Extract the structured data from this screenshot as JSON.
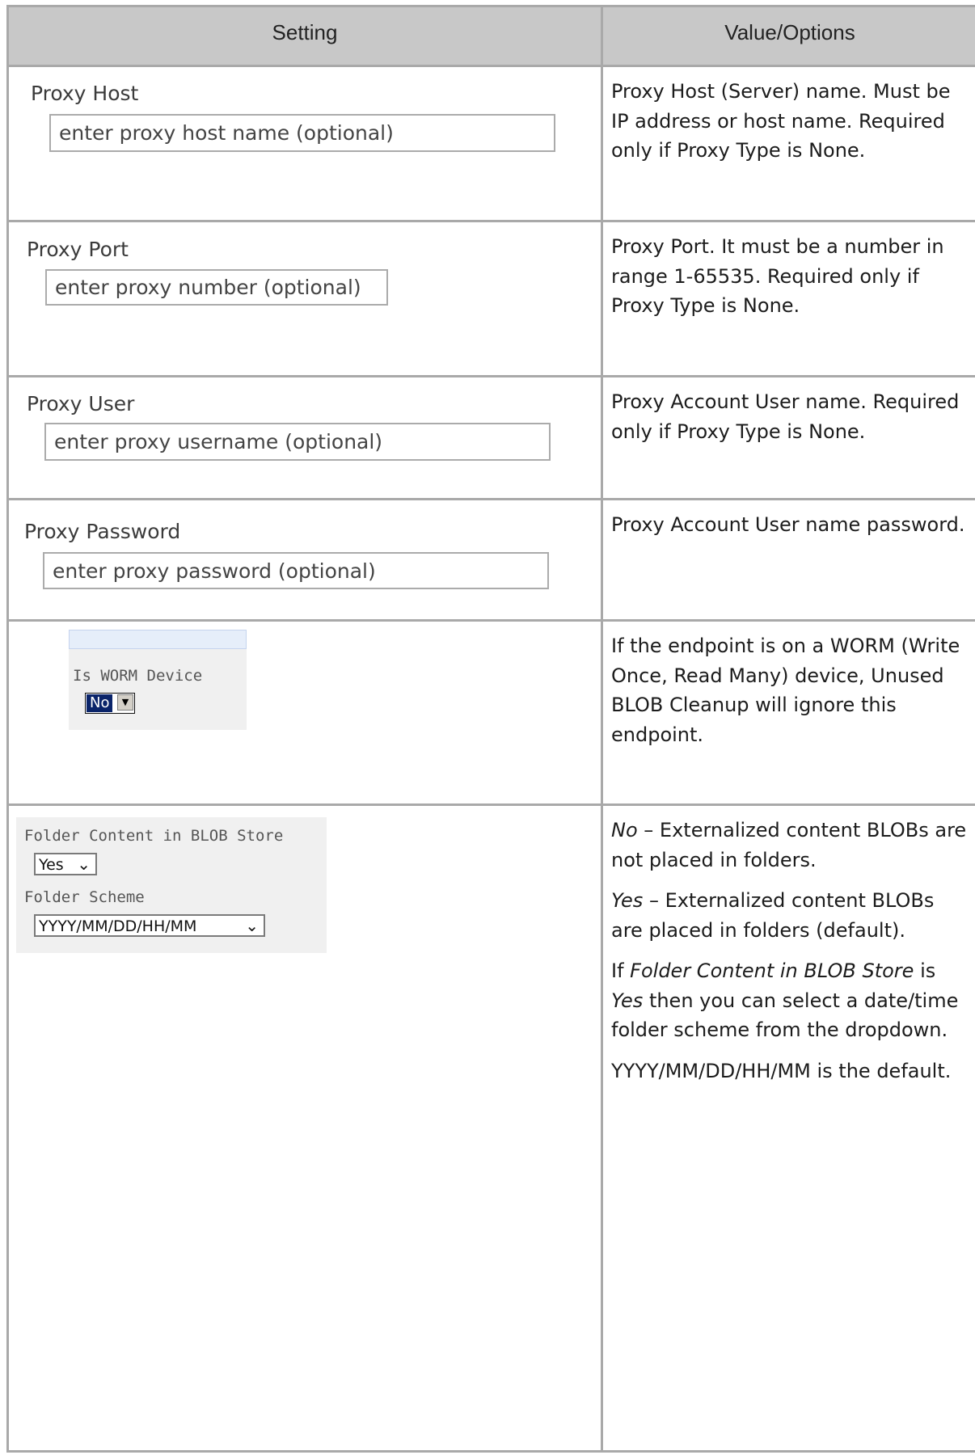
{
  "table": {
    "headers": [
      "Setting",
      "Value/Options"
    ],
    "rows": [
      {
        "setting_label": "Proxy Host",
        "placeholder": "enter proxy host name (optional)",
        "description": [
          "Proxy Host (Server) name. Must be IP address or host name. Required only if Proxy Type is None."
        ]
      },
      {
        "setting_label": "Proxy Port",
        "placeholder": "enter proxy number (optional)",
        "description": [
          "Proxy Port. It must be a number in range 1-65535. Required only if Proxy Type is None."
        ]
      },
      {
        "setting_label": "Proxy User",
        "placeholder": "enter proxy username (optional)",
        "description": [
          "Proxy Account User name. Required only if Proxy Type is None."
        ]
      },
      {
        "setting_label": "Proxy Password",
        "placeholder": "enter proxy password (optional)",
        "description": [
          "Proxy Account User name password."
        ]
      },
      {
        "setting_label": "Is WORM Device",
        "select_value": "No",
        "description": [
          "If the endpoint is on a WORM (Write Once, Read Many) device, Unused BLOB Cleanup will ignore this endpoint."
        ]
      },
      {
        "folder_content_label": "Folder Content in BLOB Store",
        "folder_content_value": "Yes",
        "folder_scheme_label": "Folder Scheme",
        "folder_scheme_value": "YYYY/MM/DD/HH/MM",
        "desc_no_term": "No",
        "desc_no_text": "– Externalized content BLOBs are not placed in folders.",
        "desc_yes_term": "Yes",
        "desc_yes_text": "– Externalized content BLOBs are placed in folders (default).",
        "desc_if_1": "If ",
        "desc_if_term1": "Folder Content in BLOB Store",
        "desc_if_2": "is ",
        "desc_if_term2": "Yes",
        "desc_if_3": "then you can select a date/time folder scheme from the dropdown.",
        "desc_default": "YYYY/MM/DD/HH/MM is the default."
      }
    ]
  }
}
